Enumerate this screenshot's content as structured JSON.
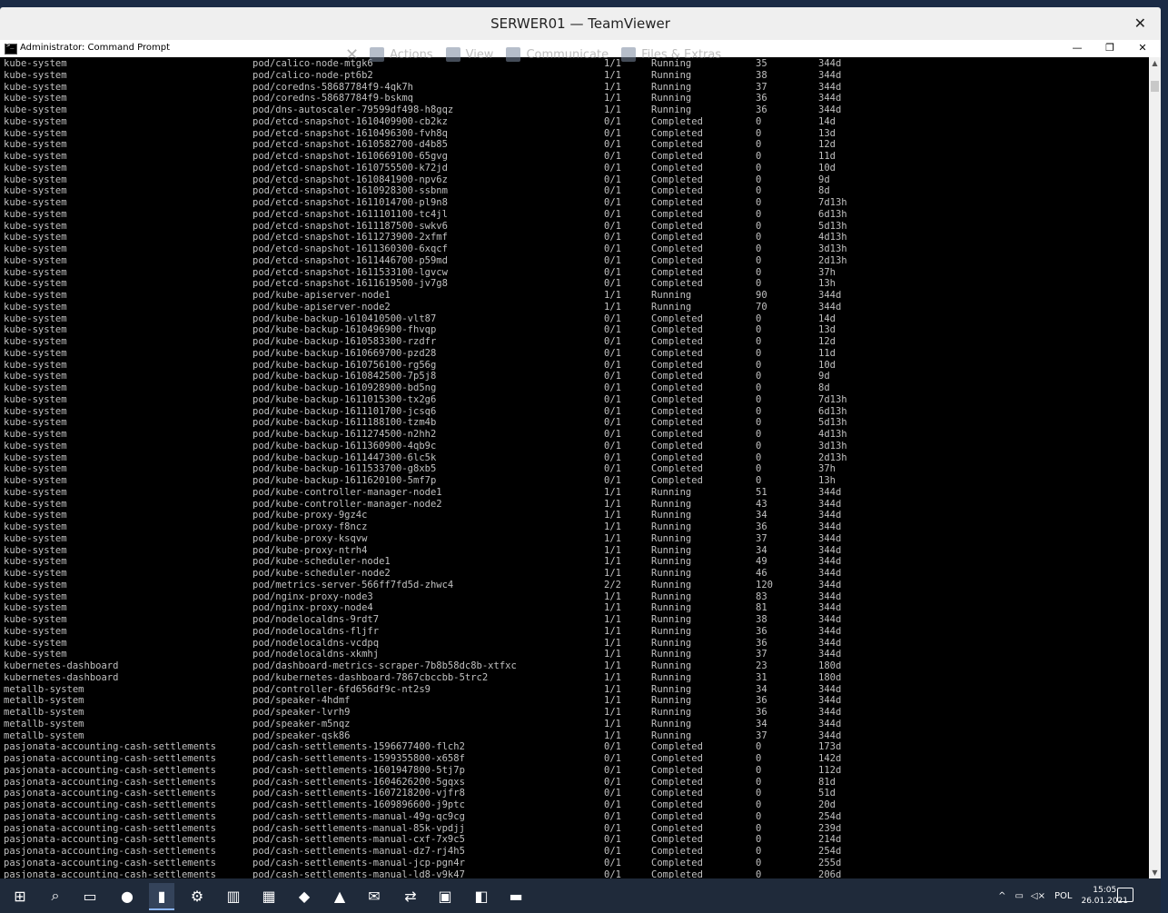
{
  "teamviewer": {
    "title": "SERWER01 — TeamViewer",
    "close": "✕",
    "toolbar": {
      "close_glyph": "✕",
      "actions": "Actions",
      "view": "View",
      "communicate": "Communicate",
      "files": "Files & Extras"
    }
  },
  "cmd": {
    "title": "Administrator: Command Prompt",
    "minimize": "—",
    "maximize": "❐",
    "close": "✕"
  },
  "rows": [
    [
      "kube-system",
      "pod/calico-node-mtgk6",
      "1/1",
      "Running",
      "35",
      "344d"
    ],
    [
      "kube-system",
      "pod/calico-node-pt6b2",
      "1/1",
      "Running",
      "38",
      "344d"
    ],
    [
      "kube-system",
      "pod/coredns-58687784f9-4qk7h",
      "1/1",
      "Running",
      "37",
      "344d"
    ],
    [
      "kube-system",
      "pod/coredns-58687784f9-bskmq",
      "1/1",
      "Running",
      "36",
      "344d"
    ],
    [
      "kube-system",
      "pod/dns-autoscaler-79599df498-h8gqz",
      "1/1",
      "Running",
      "36",
      "344d"
    ],
    [
      "kube-system",
      "pod/etcd-snapshot-1610409900-cb2kz",
      "0/1",
      "Completed",
      "0",
      "14d"
    ],
    [
      "kube-system",
      "pod/etcd-snapshot-1610496300-fvh8q",
      "0/1",
      "Completed",
      "0",
      "13d"
    ],
    [
      "kube-system",
      "pod/etcd-snapshot-1610582700-d4b85",
      "0/1",
      "Completed",
      "0",
      "12d"
    ],
    [
      "kube-system",
      "pod/etcd-snapshot-1610669100-65gvg",
      "0/1",
      "Completed",
      "0",
      "11d"
    ],
    [
      "kube-system",
      "pod/etcd-snapshot-1610755500-k72jd",
      "0/1",
      "Completed",
      "0",
      "10d"
    ],
    [
      "kube-system",
      "pod/etcd-snapshot-1610841900-npv6z",
      "0/1",
      "Completed",
      "0",
      "9d"
    ],
    [
      "kube-system",
      "pod/etcd-snapshot-1610928300-ssbnm",
      "0/1",
      "Completed",
      "0",
      "8d"
    ],
    [
      "kube-system",
      "pod/etcd-snapshot-1611014700-pl9n8",
      "0/1",
      "Completed",
      "0",
      "7d13h"
    ],
    [
      "kube-system",
      "pod/etcd-snapshot-1611101100-tc4jl",
      "0/1",
      "Completed",
      "0",
      "6d13h"
    ],
    [
      "kube-system",
      "pod/etcd-snapshot-1611187500-swkv6",
      "0/1",
      "Completed",
      "0",
      "5d13h"
    ],
    [
      "kube-system",
      "pod/etcd-snapshot-1611273900-2xfmf",
      "0/1",
      "Completed",
      "0",
      "4d13h"
    ],
    [
      "kube-system",
      "pod/etcd-snapshot-1611360300-6xqcf",
      "0/1",
      "Completed",
      "0",
      "3d13h"
    ],
    [
      "kube-system",
      "pod/etcd-snapshot-1611446700-p59md",
      "0/1",
      "Completed",
      "0",
      "2d13h"
    ],
    [
      "kube-system",
      "pod/etcd-snapshot-1611533100-lgvcw",
      "0/1",
      "Completed",
      "0",
      "37h"
    ],
    [
      "kube-system",
      "pod/etcd-snapshot-1611619500-jv7g8",
      "0/1",
      "Completed",
      "0",
      "13h"
    ],
    [
      "kube-system",
      "pod/kube-apiserver-node1",
      "1/1",
      "Running",
      "90",
      "344d"
    ],
    [
      "kube-system",
      "pod/kube-apiserver-node2",
      "1/1",
      "Running",
      "70",
      "344d"
    ],
    [
      "kube-system",
      "pod/kube-backup-1610410500-vlt87",
      "0/1",
      "Completed",
      "0",
      "14d"
    ],
    [
      "kube-system",
      "pod/kube-backup-1610496900-fhvqp",
      "0/1",
      "Completed",
      "0",
      "13d"
    ],
    [
      "kube-system",
      "pod/kube-backup-1610583300-rzdfr",
      "0/1",
      "Completed",
      "0",
      "12d"
    ],
    [
      "kube-system",
      "pod/kube-backup-1610669700-pzd28",
      "0/1",
      "Completed",
      "0",
      "11d"
    ],
    [
      "kube-system",
      "pod/kube-backup-1610756100-rg56g",
      "0/1",
      "Completed",
      "0",
      "10d"
    ],
    [
      "kube-system",
      "pod/kube-backup-1610842500-7p5j8",
      "0/1",
      "Completed",
      "0",
      "9d"
    ],
    [
      "kube-system",
      "pod/kube-backup-1610928900-bd5ng",
      "0/1",
      "Completed",
      "0",
      "8d"
    ],
    [
      "kube-system",
      "pod/kube-backup-1611015300-tx2g6",
      "0/1",
      "Completed",
      "0",
      "7d13h"
    ],
    [
      "kube-system",
      "pod/kube-backup-1611101700-jcsq6",
      "0/1",
      "Completed",
      "0",
      "6d13h"
    ],
    [
      "kube-system",
      "pod/kube-backup-1611188100-tzm4b",
      "0/1",
      "Completed",
      "0",
      "5d13h"
    ],
    [
      "kube-system",
      "pod/kube-backup-1611274500-n2hh2",
      "0/1",
      "Completed",
      "0",
      "4d13h"
    ],
    [
      "kube-system",
      "pod/kube-backup-1611360900-4qb9c",
      "0/1",
      "Completed",
      "0",
      "3d13h"
    ],
    [
      "kube-system",
      "pod/kube-backup-1611447300-6lc5k",
      "0/1",
      "Completed",
      "0",
      "2d13h"
    ],
    [
      "kube-system",
      "pod/kube-backup-1611533700-g8xb5",
      "0/1",
      "Completed",
      "0",
      "37h"
    ],
    [
      "kube-system",
      "pod/kube-backup-1611620100-5mf7p",
      "0/1",
      "Completed",
      "0",
      "13h"
    ],
    [
      "kube-system",
      "pod/kube-controller-manager-node1",
      "1/1",
      "Running",
      "51",
      "344d"
    ],
    [
      "kube-system",
      "pod/kube-controller-manager-node2",
      "1/1",
      "Running",
      "43",
      "344d"
    ],
    [
      "kube-system",
      "pod/kube-proxy-9gz4c",
      "1/1",
      "Running",
      "34",
      "344d"
    ],
    [
      "kube-system",
      "pod/kube-proxy-f8ncz",
      "1/1",
      "Running",
      "36",
      "344d"
    ],
    [
      "kube-system",
      "pod/kube-proxy-ksqvw",
      "1/1",
      "Running",
      "37",
      "344d"
    ],
    [
      "kube-system",
      "pod/kube-proxy-ntrh4",
      "1/1",
      "Running",
      "34",
      "344d"
    ],
    [
      "kube-system",
      "pod/kube-scheduler-node1",
      "1/1",
      "Running",
      "49",
      "344d"
    ],
    [
      "kube-system",
      "pod/kube-scheduler-node2",
      "1/1",
      "Running",
      "46",
      "344d"
    ],
    [
      "kube-system",
      "pod/metrics-server-566ff7fd5d-zhwc4",
      "2/2",
      "Running",
      "120",
      "344d"
    ],
    [
      "kube-system",
      "pod/nginx-proxy-node3",
      "1/1",
      "Running",
      "83",
      "344d"
    ],
    [
      "kube-system",
      "pod/nginx-proxy-node4",
      "1/1",
      "Running",
      "81",
      "344d"
    ],
    [
      "kube-system",
      "pod/nodelocaldns-9rdt7",
      "1/1",
      "Running",
      "38",
      "344d"
    ],
    [
      "kube-system",
      "pod/nodelocaldns-fljfr",
      "1/1",
      "Running",
      "36",
      "344d"
    ],
    [
      "kube-system",
      "pod/nodelocaldns-vcdpq",
      "1/1",
      "Running",
      "36",
      "344d"
    ],
    [
      "kube-system",
      "pod/nodelocaldns-xkmhj",
      "1/1",
      "Running",
      "37",
      "344d"
    ],
    [
      "kubernetes-dashboard",
      "pod/dashboard-metrics-scraper-7b8b58dc8b-xtfxc",
      "1/1",
      "Running",
      "23",
      "180d"
    ],
    [
      "kubernetes-dashboard",
      "pod/kubernetes-dashboard-7867cbccbb-5trc2",
      "1/1",
      "Running",
      "31",
      "180d"
    ],
    [
      "metallb-system",
      "pod/controller-6fd656df9c-nt2s9",
      "1/1",
      "Running",
      "34",
      "344d"
    ],
    [
      "metallb-system",
      "pod/speaker-4hdmf",
      "1/1",
      "Running",
      "36",
      "344d"
    ],
    [
      "metallb-system",
      "pod/speaker-lvrh9",
      "1/1",
      "Running",
      "36",
      "344d"
    ],
    [
      "metallb-system",
      "pod/speaker-m5nqz",
      "1/1",
      "Running",
      "34",
      "344d"
    ],
    [
      "metallb-system",
      "pod/speaker-qsk86",
      "1/1",
      "Running",
      "37",
      "344d"
    ],
    [
      "pasjonata-accounting-cash-settlements",
      "pod/cash-settlements-1596677400-flch2",
      "0/1",
      "Completed",
      "0",
      "173d"
    ],
    [
      "pasjonata-accounting-cash-settlements",
      "pod/cash-settlements-1599355800-x658f",
      "0/1",
      "Completed",
      "0",
      "142d"
    ],
    [
      "pasjonata-accounting-cash-settlements",
      "pod/cash-settlements-1601947800-5tj7p",
      "0/1",
      "Completed",
      "0",
      "112d"
    ],
    [
      "pasjonata-accounting-cash-settlements",
      "pod/cash-settlements-1604626200-5gqxs",
      "0/1",
      "Completed",
      "0",
      "81d"
    ],
    [
      "pasjonata-accounting-cash-settlements",
      "pod/cash-settlements-1607218200-vjfr8",
      "0/1",
      "Completed",
      "0",
      "51d"
    ],
    [
      "pasjonata-accounting-cash-settlements",
      "pod/cash-settlements-1609896600-j9ptc",
      "0/1",
      "Completed",
      "0",
      "20d"
    ],
    [
      "pasjonata-accounting-cash-settlements",
      "pod/cash-settlements-manual-49g-qc9cg",
      "0/1",
      "Completed",
      "0",
      "254d"
    ],
    [
      "pasjonata-accounting-cash-settlements",
      "pod/cash-settlements-manual-85k-vpdjj",
      "0/1",
      "Completed",
      "0",
      "239d"
    ],
    [
      "pasjonata-accounting-cash-settlements",
      "pod/cash-settlements-manual-cxf-7x9c5",
      "0/1",
      "Completed",
      "0",
      "214d"
    ],
    [
      "pasjonata-accounting-cash-settlements",
      "pod/cash-settlements-manual-dz7-rj4h5",
      "0/1",
      "Completed",
      "0",
      "254d"
    ],
    [
      "pasjonata-accounting-cash-settlements",
      "pod/cash-settlements-manual-jcp-pgn4r",
      "0/1",
      "Completed",
      "0",
      "255d"
    ],
    [
      "pasjonata-accounting-cash-settlements",
      "pod/cash-settlements-manual-ld8-v9k47",
      "0/1",
      "Completed",
      "0",
      "206d"
    ]
  ],
  "taskbar": {
    "icons": [
      "windows-start-icon",
      "search-icon",
      "task-view-icon",
      "firefox-icon",
      "command-prompt-icon",
      "settings-icon",
      "server-manager-icon",
      "file-explorer-green-icon",
      "red-app-icon",
      "acrobat-icon",
      "network-tool-icon",
      "teamviewer-icon",
      "usb-drive-icon",
      "remote-desktop-icon",
      "folder-icon"
    ],
    "glyphs": [
      "⊞",
      "⌕",
      "▭",
      "●",
      "▮",
      "⚙",
      "▥",
      "▦",
      "◆",
      "▲",
      "✉",
      "⇄",
      "▣",
      "◧",
      "▬"
    ],
    "tray": {
      "chevron": "^",
      "lang": "POL",
      "time": "15:05",
      "date": "26.01.2021"
    }
  },
  "colors": {
    "console_text": "#c0c0c0",
    "console_bg": "#000000",
    "taskbar_bg": "#1f2a3a"
  }
}
